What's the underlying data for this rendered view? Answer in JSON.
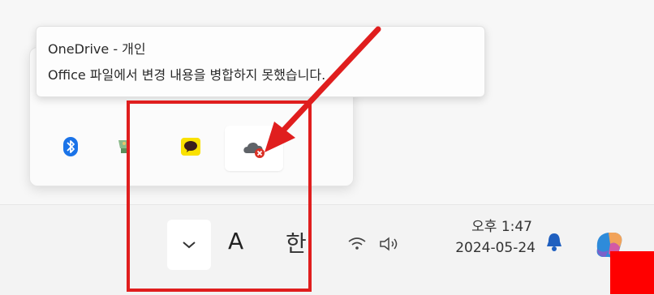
{
  "tooltip": {
    "title": "OneDrive - 개인",
    "message": "Office 파일에서 변경 내용을 병합하지 못했습니다."
  },
  "tray_flyout": {
    "icons": [
      "bluetooth-icon",
      "usb-device-icon",
      "kakaotalk-icon",
      "onedrive-error-icon"
    ],
    "selected": "onedrive-error-icon"
  },
  "taskbar": {
    "overflow_chevron": "chevron-up-icon",
    "ime_mode": "A",
    "ime_language": "한",
    "time": "오후 1:47",
    "date": "2024-05-24"
  },
  "colors": {
    "annotation_red": "#e01e1e",
    "bluetooth_blue": "#1a73e8",
    "kakao_yellow": "#fae100",
    "error_red": "#d93025"
  }
}
